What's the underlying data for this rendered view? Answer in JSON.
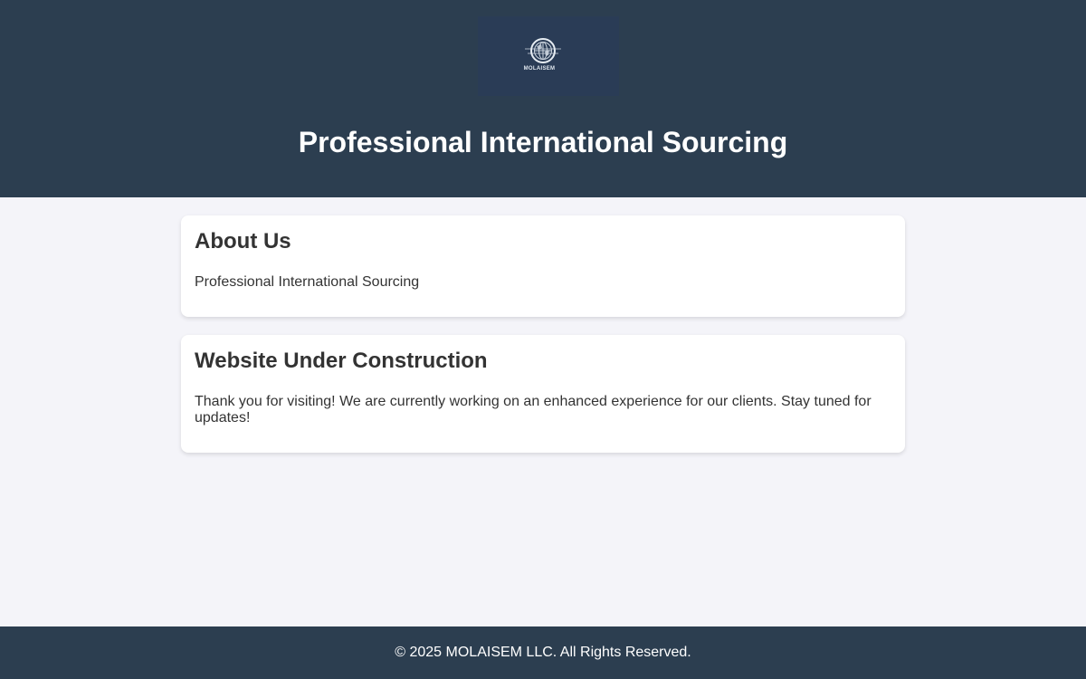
{
  "header": {
    "logo_text": "MOLAISEM",
    "title": "Professional International Sourcing"
  },
  "about": {
    "heading": "About Us",
    "text": "Professional International Sourcing"
  },
  "construction": {
    "heading": "Website Under Construction",
    "text": "Thank you for visiting! We are currently working on an enhanced experience for our clients. Stay tuned for updates!"
  },
  "footer": {
    "copyright": "© 2025 MOLAISEM LLC. All Rights Reserved."
  },
  "colors": {
    "header_bg": "#2c3e50",
    "page_bg": "#f4f4f9",
    "card_bg": "#ffffff",
    "text": "#333333"
  }
}
